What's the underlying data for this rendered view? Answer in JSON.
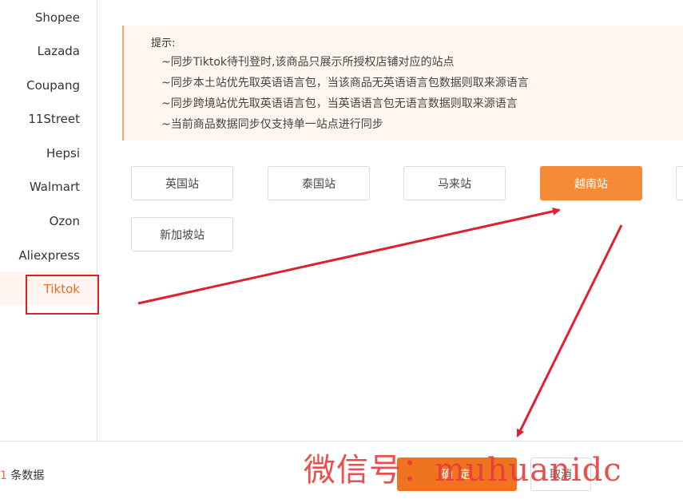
{
  "sidebar": {
    "items": [
      {
        "label": "Shopee"
      },
      {
        "label": "Lazada"
      },
      {
        "label": "Coupang"
      },
      {
        "label": "11Street"
      },
      {
        "label": "Hepsi"
      },
      {
        "label": "Walmart"
      },
      {
        "label": "Ozon"
      },
      {
        "label": "Aliexpress"
      },
      {
        "label": "Tiktok"
      }
    ],
    "active": "Tiktok"
  },
  "notice": {
    "title": "提示:",
    "lines": [
      "~同步Tiktok待刊登时,该商品只展示所授权店铺对应的站点",
      "~同步本土站优先取英语语言包，当该商品无英语语言包数据则取来源语言",
      "~同步跨境站优先取英语语言包，当英语语言包无语言数据则取来源语言",
      "~当前商品数据同步仅支持单一站点进行同步"
    ]
  },
  "sites": [
    {
      "label": "英国站"
    },
    {
      "label": "泰国站"
    },
    {
      "label": "马来站"
    },
    {
      "label": "越南站"
    },
    {
      "label": "新加坡站"
    }
  ],
  "selected_site": "越南站",
  "footer": {
    "count_num": "1",
    "count_text": " 条数据",
    "confirm_label": "确 定",
    "cancel_label": "取消"
  },
  "watermark": "微信号：muhuanidc",
  "colors": {
    "accent": "#f58b35",
    "confirm": "#f0731f",
    "arrow": "#e02030",
    "notice_bg": "#fff6ef"
  }
}
